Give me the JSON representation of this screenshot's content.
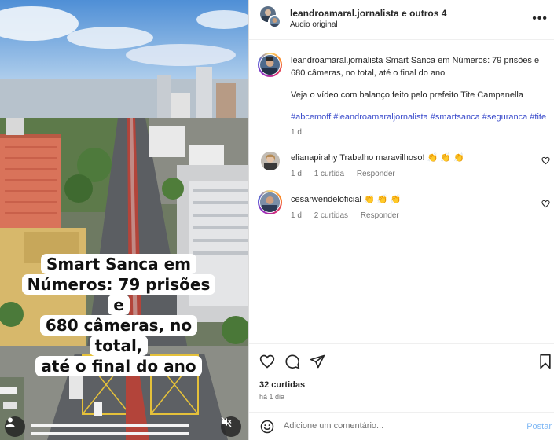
{
  "media": {
    "caption_lines": [
      "Smart Sanca em",
      "Números: 79 prisões e",
      "680 câmeras, no total,",
      "até o final do ano"
    ]
  },
  "header": {
    "title": "leandroamaral.jornalista e outros 4",
    "audio_label": "Áudio original"
  },
  "post": {
    "author": "leandroamaral.jornalista",
    "text": "Smart Sanca em Números: 79 prisões e 680 câmeras, no total, até o final do ano",
    "line2": "Veja o vídeo com balanço feito pelo prefeito Tite Campanella",
    "hashtags": "#abcemoff #leandroamaraljornalista #smartsanca #seguranca #tite",
    "time": "1 d"
  },
  "comments": [
    {
      "user": "elianapirahy",
      "text": "Trabalho maravilhoso! 👏 👏 👏",
      "time": "1 d",
      "likes": "1 curtida",
      "reply": "Responder"
    },
    {
      "user": "cesarwendeloficial",
      "text": "👏 👏 👏",
      "time": "1 d",
      "likes": "2 curtidas",
      "reply": "Responder"
    }
  ],
  "likes_count": "32 curtidas",
  "post_age": "há 1 dia",
  "comment_box": {
    "placeholder": "Adicione um comentário...",
    "post_label": "Postar"
  },
  "icons": [
    "more-icon",
    "heart-icon",
    "comment-icon",
    "share-icon",
    "bookmark-icon",
    "emoji-icon",
    "mute-icon",
    "user-tag-icon"
  ],
  "colors": {
    "link": "#00376b",
    "hashtag": "#3a4bcb",
    "post_disabled": "#7fb8f5"
  }
}
